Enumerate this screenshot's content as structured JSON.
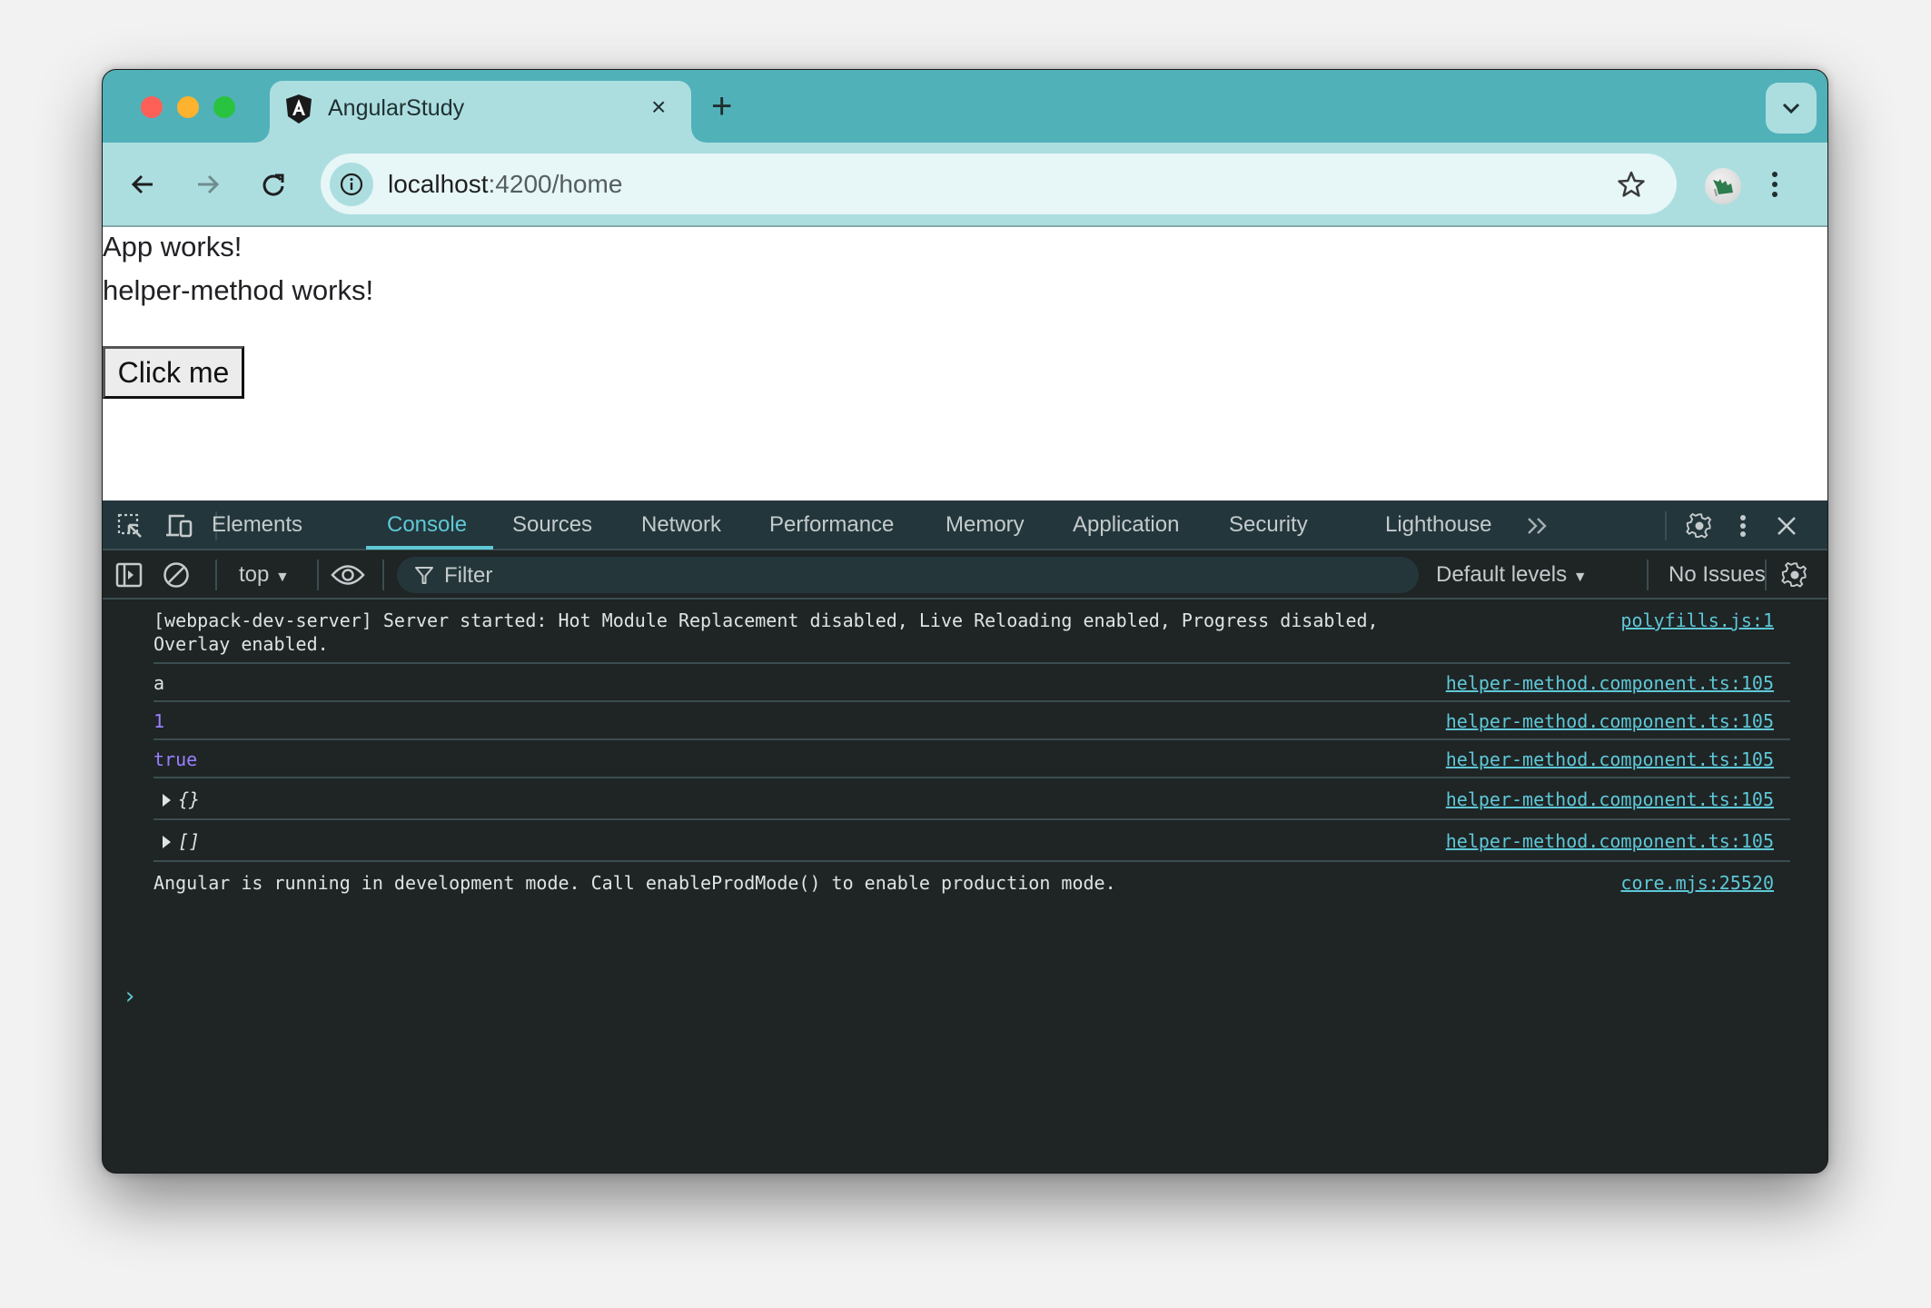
{
  "browser": {
    "tab": {
      "title": "AngularStudy",
      "favicon": "angular-logo-icon",
      "close_glyph": "×"
    },
    "new_tab_glyph": "+",
    "omnibox": {
      "host": "localhost",
      "path": ":4200/home"
    },
    "icons": {
      "back": "back-arrow-icon",
      "forward": "forward-arrow-icon",
      "reload": "reload-icon",
      "site_info": "info-icon",
      "bookmark": "star-icon",
      "profile": "avatar",
      "menu": "kebab-menu-icon",
      "tab_search": "chevron-down-icon"
    }
  },
  "page": {
    "line1": "App works!",
    "line2": "helper-method works!",
    "button_label": "Click me"
  },
  "devtools": {
    "tabs": [
      "Elements",
      "Console",
      "Sources",
      "Network",
      "Performance",
      "Memory",
      "Application",
      "Security",
      "Lighthouse"
    ],
    "active_tab": "Console",
    "more_tabs_glyph": "»",
    "console_toolbar": {
      "context": "top",
      "filter_placeholder": "Filter",
      "levels": "Default levels",
      "issues": "No Issues"
    },
    "messages": [
      {
        "text": "[webpack-dev-server] Server started: Hot Module Replacement disabled, Live Reloading enabled, Progress disabled,\nOverlay enabled.",
        "source": "polyfills.js:1",
        "kind": "text"
      },
      {
        "text": "a",
        "source": "helper-method.component.ts:105",
        "kind": "text"
      },
      {
        "text": "1",
        "source": "helper-method.component.ts:105",
        "kind": "number"
      },
      {
        "text": "true",
        "source": "helper-method.component.ts:105",
        "kind": "number"
      },
      {
        "text": "{}",
        "source": "helper-method.component.ts:105",
        "kind": "object"
      },
      {
        "text": "[]",
        "source": "helper-method.component.ts:105",
        "kind": "object"
      },
      {
        "text": "Angular is running in development mode. Call enableProdMode() to enable production mode.",
        "source": "core.mjs:25520",
        "kind": "text"
      }
    ],
    "prompt_glyph": "›"
  },
  "colors": {
    "tabstrip": "#51b1b9",
    "toolbar": "#acdee0",
    "accent": "#5ec8d6",
    "number": "#9980ff"
  }
}
